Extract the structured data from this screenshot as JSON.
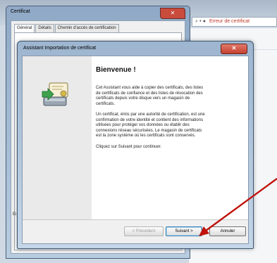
{
  "browser": {
    "address_text": "Erreur de certificat",
    "address_icons": "⌕ ▾ ●"
  },
  "cert_window": {
    "title": "Certificat",
    "close_glyph": "✕",
    "tabs": [
      "Général",
      "Détails",
      "Chemin d'accès de certification"
    ],
    "side_text": "Ei"
  },
  "wizard": {
    "title": "Assistant Importation de certificat",
    "close_glyph": "✕",
    "heading": "Bienvenue !",
    "paragraphs": [
      "Cet Assistant vous aide à copier des certificats, des listes de certificats de confiance et des listes de révocation des certificats depuis votre disque vers un magasin de certificats.",
      "Un certificat, émis par une autorité de certification, est une confirmation de votre identité et contient des informations utilisées pour protéger vos données ou établir des connexions réseau sécurisées. Le magasin de certificats est la zone système où les certificats sont conservés.",
      "Cliquez sur Suivant pour continuer."
    ],
    "buttons": {
      "previous": "< Précédent",
      "next": "Suivant >",
      "cancel": "Annuler"
    }
  },
  "colors": {
    "annotation_arrow": "#c0120b",
    "close_button": "#c4402f"
  }
}
